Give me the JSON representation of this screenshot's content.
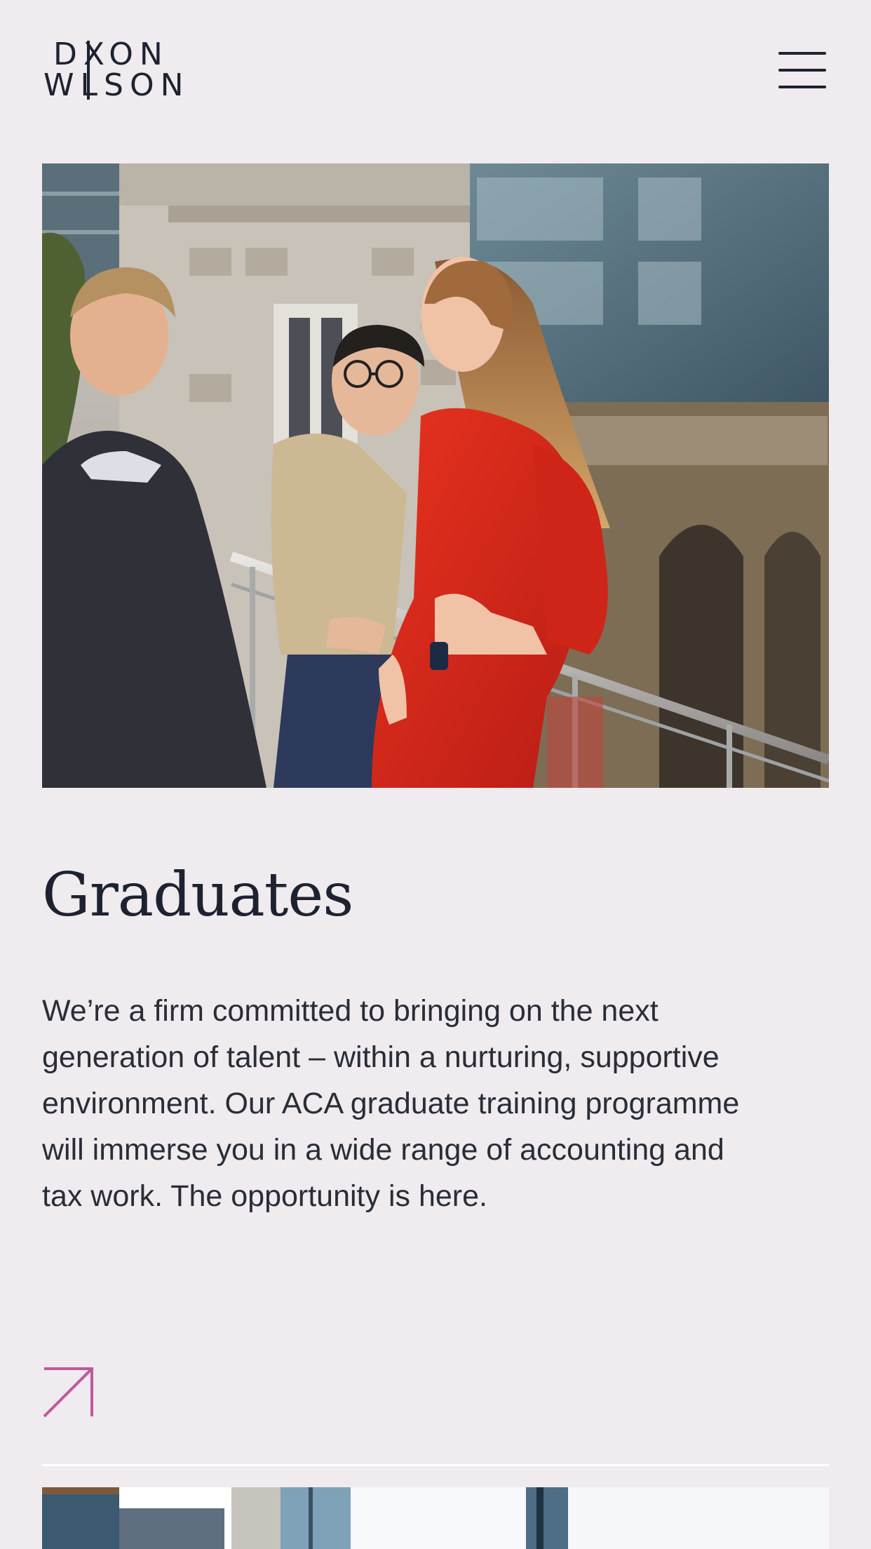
{
  "header": {
    "logo_line1": "DXON",
    "logo_line2": "WLSON",
    "logo_name": "Dixon Wilson"
  },
  "menu": {
    "icon": "hamburger-menu-icon"
  },
  "card": {
    "title": "Graduates",
    "body": "We’re a firm committed to bringing on the next generation of talent – within a nurturing, supportive environment. Our ACA graduate training programme will immerse you in a wide range of accounting and tax work. The opportunity is here.",
    "link_icon": "arrow-up-right-icon"
  },
  "colors": {
    "background": "#efebee",
    "text": "#1e2230",
    "accent": "#c0589c",
    "divider": "#ffffff"
  }
}
